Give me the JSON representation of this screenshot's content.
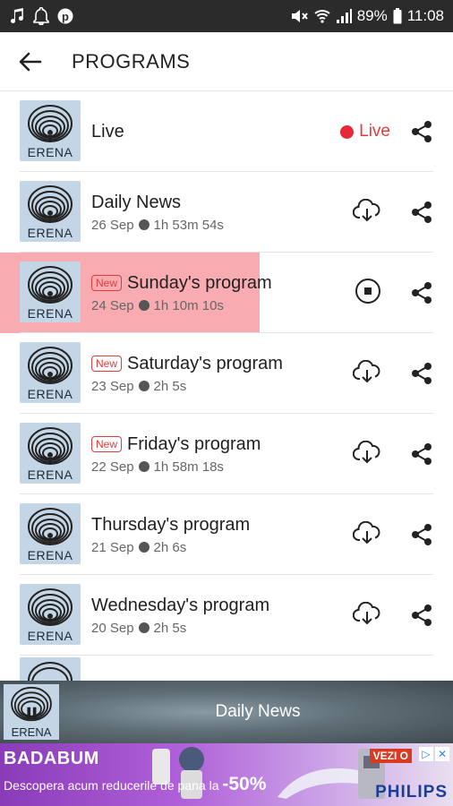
{
  "status_bar": {
    "battery": "89%",
    "time": "11:08"
  },
  "header": {
    "title": "PROGRAMS"
  },
  "thumb_brand": "ERENA",
  "live_item": {
    "title": "Live",
    "badge": "Live"
  },
  "items": [
    {
      "title": "Daily News",
      "is_new": false,
      "date": "26 Sep",
      "duration": "1h 53m 54s",
      "action": "download"
    },
    {
      "title": "Sunday's program",
      "is_new": true,
      "date": "24 Sep",
      "duration": "1h 10m 10s",
      "action": "stop"
    },
    {
      "title": "Saturday's program",
      "is_new": true,
      "date": "23 Sep",
      "duration": "2h 5s",
      "action": "download"
    },
    {
      "title": "Friday's program",
      "is_new": true,
      "date": "22 Sep",
      "duration": "1h 58m 18s",
      "action": "download"
    },
    {
      "title": "Thursday's program",
      "is_new": false,
      "date": "21 Sep",
      "duration": "2h 6s",
      "action": "download"
    },
    {
      "title": "Wednesday's program",
      "is_new": false,
      "date": "20 Sep",
      "duration": "2h 5s",
      "action": "download"
    }
  ],
  "new_badge_label": "New",
  "player": {
    "now_playing": "Daily News"
  },
  "ad": {
    "brand": "BADABUM",
    "text": "Descopera acum reducerile de pana la",
    "discount": "-50%",
    "cta": "VEZI O",
    "logo": "PHILIPS"
  },
  "colors": {
    "accent_red": "#e23b3b",
    "highlight": "#f7a3a8",
    "status_bar": "#2b2b2b"
  }
}
